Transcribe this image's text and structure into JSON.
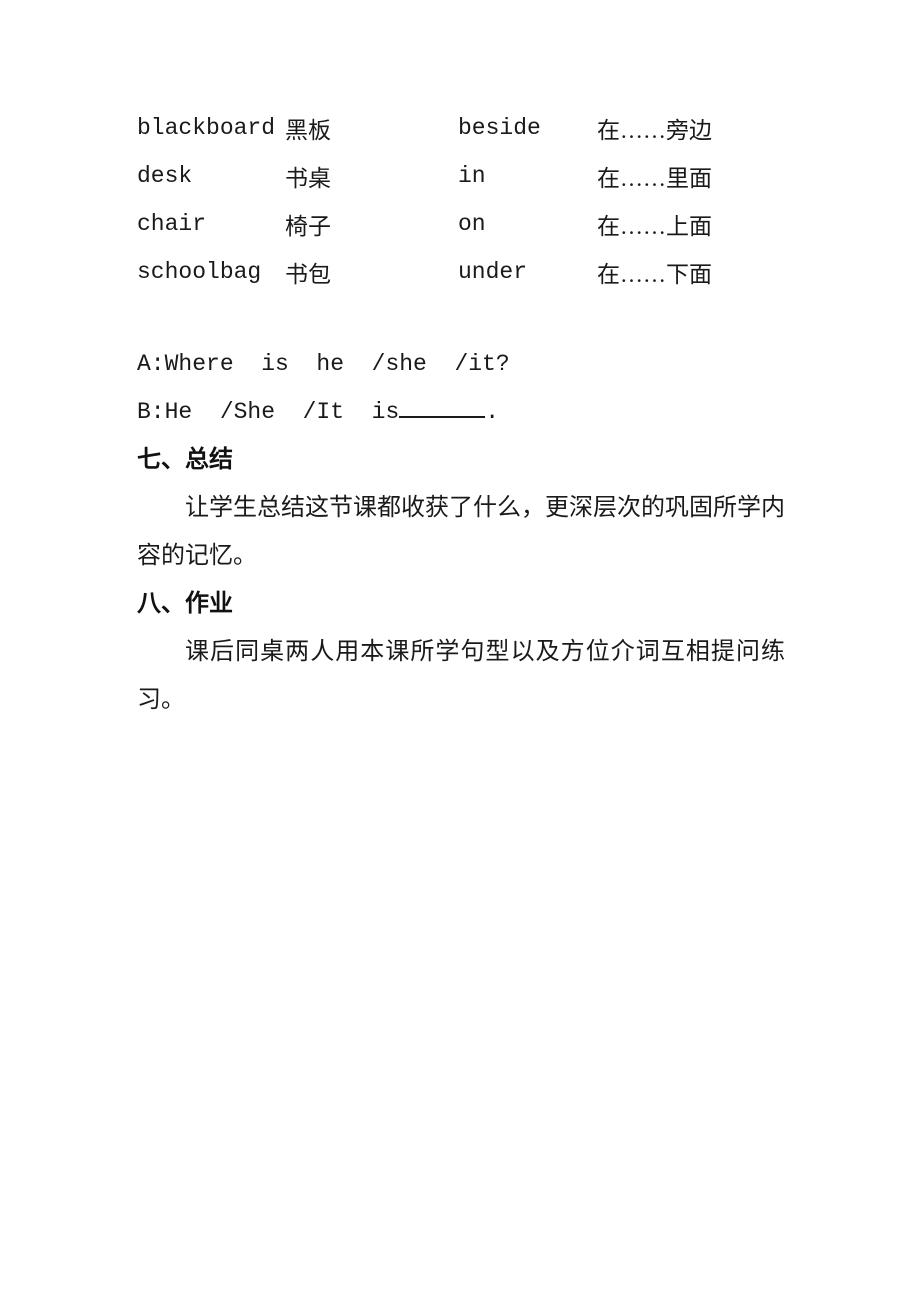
{
  "document": {
    "page_background": "#ffffff",
    "text_color": "#1a1a1a",
    "vocabulary": {
      "rows": [
        {
          "english": "blackboard",
          "chinese": "黑板",
          "preposition": "beside",
          "preposition_cn": "在……旁边"
        },
        {
          "english": "desk",
          "chinese": "书桌",
          "preposition": "in",
          "preposition_cn": "在……里面"
        },
        {
          "english": "chair",
          "chinese": "椅子",
          "preposition": "on",
          "preposition_cn": "在……上面"
        },
        {
          "english": "schoolbag",
          "chinese": "书包",
          "preposition": "under",
          "preposition_cn": "在……下面"
        }
      ]
    },
    "dialogue": {
      "question": "A:Where  is  he  /she  /it?",
      "answer_prefix": "B:He  /She  /It  is",
      "answer_suffix": "."
    },
    "sections": [
      {
        "heading": "七、总结",
        "body": "让学生总结这节课都收获了什么，更深层次的巩固所学内容的记忆。"
      },
      {
        "heading": "八、作业",
        "body": "课后同桌两人用本课所学句型以及方位介词互相提问练习。"
      }
    ]
  }
}
